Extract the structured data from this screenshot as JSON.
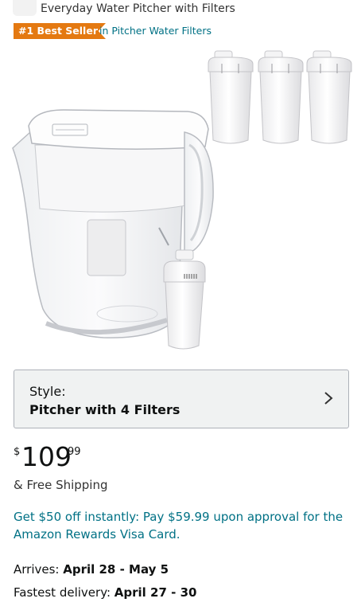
{
  "product": {
    "title": "Everyday Water Pitcher with Filters"
  },
  "badges": {
    "bestseller": "#1 Best Seller",
    "category": "in Pitcher Water Filters"
  },
  "style": {
    "label": "Style:",
    "value": "Pitcher with 4 Filters"
  },
  "price": {
    "symbol": "$",
    "whole": "109",
    "fraction": "99"
  },
  "shipping": "& Free Shipping",
  "promo": "Get $50 off instantly: Pay $59.99 upon approval for the Amazon Rewards Visa Card.",
  "delivery": {
    "arrives_label": "Arrives: ",
    "arrives_value": "April 28 - May 5",
    "fastest_label": "Fastest delivery: ",
    "fastest_value": "April 27 - 30"
  },
  "colors": {
    "badge": "#e47911",
    "link": "#007185",
    "selector_bg": "#f0f2f2"
  }
}
